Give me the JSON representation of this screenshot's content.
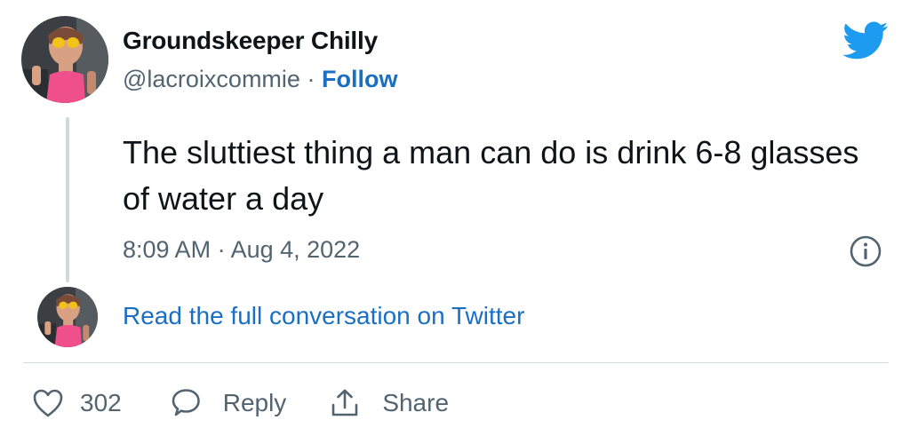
{
  "author": {
    "display_name": "Groundskeeper Chilly",
    "handle": "@lacroixcommie",
    "separator": "·",
    "follow_label": "Follow",
    "avatar_icon": "profile-photo-avatar"
  },
  "brand": {
    "icon": "twitter-bird-icon",
    "color": "#1d9bf0"
  },
  "tweet": {
    "text": "The sluttiest thing a man can do is drink 6-8 glasses of water a day",
    "timestamp": "8:09 AM · Aug 4, 2022",
    "info_icon": "info-circle-icon"
  },
  "conversation": {
    "link_text": "Read the full conversation on Twitter"
  },
  "actions": {
    "like_icon": "heart-icon",
    "like_count": "302",
    "reply_icon": "speech-bubble-icon",
    "reply_label": "Reply",
    "share_icon": "share-arrow-icon",
    "share_label": "Share"
  },
  "colors": {
    "text_primary": "#0f1419",
    "text_secondary": "#536471",
    "link": "#1b6fc2",
    "divider": "#cfd9de"
  }
}
